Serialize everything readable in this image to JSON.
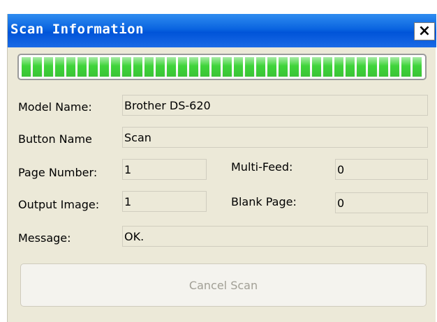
{
  "window": {
    "title": "Scan Information",
    "close_symbol": "×"
  },
  "progress": {
    "value": 1.0
  },
  "fields": {
    "model_name": {
      "label": "Model Name:",
      "value": "Brother DS-620"
    },
    "button_name": {
      "label": "Button Name",
      "value": "Scan"
    },
    "page_number": {
      "label": "Page Number:",
      "value": "1"
    },
    "multi_feed": {
      "label": "Multi-Feed:",
      "value": "0"
    },
    "output_image": {
      "label": "Output Image:",
      "value": "1"
    },
    "blank_page": {
      "label": "Blank Page:",
      "value": "0"
    },
    "message": {
      "label": "Message:",
      "value": "OK."
    }
  },
  "buttons": {
    "cancel_label": "Cancel Scan"
  },
  "colors": {
    "title_bar": "#0a64e0",
    "progress_green": "#3fd43a",
    "dialog_bg": "#ece9d8",
    "disabled_text": "#a19f95"
  },
  "icons": {
    "close": "close-icon"
  }
}
